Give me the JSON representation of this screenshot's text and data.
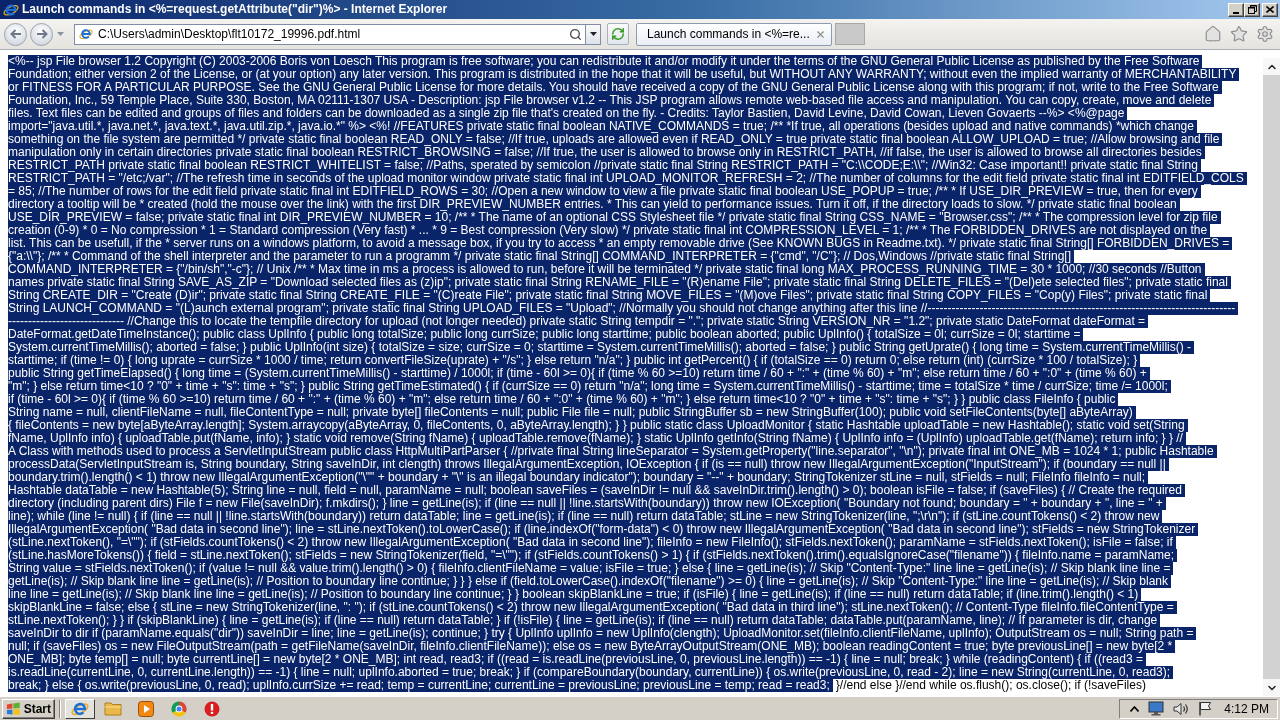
{
  "window": {
    "title": "Launch commands in <%=request.getAttribute(\"dir\")%> - Internet Explorer"
  },
  "address_bar": {
    "url": "C:\\Users\\admin\\Desktop\\flt10172_19996.pdf.html"
  },
  "tabs": [
    {
      "title": "Launch commands in <%=re...",
      "selected": true
    }
  ],
  "document": {
    "lines": [
      [
        {
          "text": "<%-- jsp File browser 1.2 Copyright (C) 2003-2006 Boris von Loesch This program is free software; you can redistribute it and/or modify it under the terms of the GNU General Public License as published by the Free Software",
          "selected": true
        }
      ],
      [
        {
          "text": "Foundation; either version 2 of the License, or (at your option) any later version. This program is distributed in the hope that it will be useful, but WITHOUT ANY WARRANTY; without even the implied warranty of MERCHANTABILITY",
          "selected": true
        }
      ],
      [
        {
          "text": "or FITNESS FOR A PARTICULAR PURPOSE. See the GNU General Public License for more details. You should have received a copy of the GNU General Public License along with this program; if not, write to the Free Software",
          "selected": true
        }
      ],
      [
        {
          "text": "Foundation, Inc., 59 Temple Place, Suite 330, Boston, MA 02111-1307 USA - Description: jsp File browser v1.2 -- This JSP program allows remote web-based file access and manipulation. You can copy, create, move and delete",
          "selected": true
        }
      ],
      [
        {
          "text": "files. Text files can be edited and groups of files and folders can be downloaded as a single zip file that's created on the fly. - Credits: Taylor Bastien, David Levine, David Cowan, Lieven Govaerts --%> <%@page",
          "selected": true
        }
      ],
      [
        {
          "text": "import=\"java.util.*, java.net.*, java.text.*, java.util.zip.*, java.io.*\" %> <%! //FEATURES private static final boolean NATIVE_COMMANDS = true; /** *If true, all operations (besides upload and native commands) *which change",
          "selected": true
        }
      ],
      [
        {
          "text": "something on the file system are permitted */ private static final boolean READ_ONLY = false; //If true, uploads are allowed even if READ_ONLY = true private static final boolean ALLOW_UPLOAD = true; //Allow browsing and file",
          "selected": true
        }
      ],
      [
        {
          "text": "manipulation only in certain directories private static final boolean RESTRICT_BROWSING = false; //If true, the user is allowed to browse only in RESTRICT_PATH, //if false, the user is allowed to browse all directories besides",
          "selected": true
        }
      ],
      [
        {
          "text": "RESTRICT_PATH private static final boolean RESTRICT_WHITELIST = false; //Paths, sperated by semicolon //private static final String RESTRICT_PATH = \"C:\\\\CODE;E:\\\\\"; //Win32: Case important!! private static final String",
          "selected": true
        }
      ],
      [
        {
          "text": "RESTRICT_PATH = \"/etc;/var\"; //The refresh time in seconds of the upload monitor window private static final int UPLOAD_MONITOR_REFRESH = 2; //The number of columns for the edit field private static final int EDITFIELD_COLS",
          "selected": true
        }
      ],
      [
        {
          "text": "= 85; //The number of rows for the edit field private static final int EDITFIELD_ROWS = 30; //Open a new window to view a file private static final boolean USE_POPUP = true; /** * If USE_DIR_PREVIEW = true, then for every",
          "selected": true
        }
      ],
      [
        {
          "text": "directory a tooltip will be * created (hold the mouse over the link) with the first DIR_PREVIEW_NUMBER entries. * This can yield to performance issues. Turn it off, if the directory loads to slow. */ private static final boolean",
          "selected": true
        }
      ],
      [
        {
          "text": "USE_DIR_PREVIEW = false; private static final int DIR_PREVIEW_NUMBER = 10; /** * The name of an optional CSS Stylesheet file */ private static final String CSS_NAME = \"Browser.css\"; /** * The compression level for zip file",
          "selected": true
        }
      ],
      [
        {
          "text": "creation (0-9) * 0 = No compression * 1 = Standard compression (Very fast) * ... * 9 = Best compression (Very slow) */ private static final int COMPRESSION_LEVEL = 1; /** * The FORBIDDEN_DRIVES are not displayed on the",
          "selected": true
        }
      ],
      [
        {
          "text": "list. This can be usefull, if the * server runs on a windows platform, to avoid a message box, if you try to access * an empty removable drive (See KNOWN BUGS in Readme.txt). */ private static final String[] FORBIDDEN_DRIVES =",
          "selected": true
        }
      ],
      [
        {
          "text": "{\"a:\\\\\"}; /** * Command of the shell interpreter and the parameter to run a programm */ private static final String[] COMMAND_INTERPRETER = {\"cmd\", \"/C\"}; // Dos,Windows //private static final String[]",
          "selected": true
        }
      ],
      [
        {
          "text": "COMMAND_INTERPRETER = {\"/bin/sh\",\"-c\"}; // Unix /** * Max time in ms a process is allowed to run, before it will be terminated */ private static final long MAX_PROCESS_RUNNING_TIME = 30 * 1000; //30 seconds //Button",
          "selected": true
        }
      ],
      [
        {
          "text": "names private static final String SAVE_AS_ZIP = \"Download selected files as (z)ip\"; private static final String RENAME_FILE = \"(R)ename File\"; private static final String DELETE_FILES = \"(Del)ete selected files\"; private static final",
          "selected": true
        }
      ],
      [
        {
          "text": "String CREATE_DIR = \"Create (D)ir\"; private static final String CREATE_FILE = \"(C)reate File\"; private static final String MOVE_FILES = \"(M)ove Files\"; private static final String COPY_FILES = \"Cop(y) Files\"; private static final",
          "selected": true
        }
      ],
      [
        {
          "text": "String LAUNCH_COMMAND = \"(L)aunch external program\"; private static final String UPLOAD_FILES = \"Upload\"; //Normally you should not change anything after this line //-----------------------------------------------------------------------------",
          "selected": true
        }
      ],
      [
        {
          "text": "----------------------------- //Change this to locate the tempfile directory for upload (not longer needed) private static String tempdir = \".\"; private static String VERSION_NR = \"1.2\"; private static DateFormat dateFormat =",
          "selected": true
        }
      ],
      [
        {
          "text": "DateFormat.getDateTimeInstance(); public class UplInfo { public long totalSize; public long currSize; public long starttime; public boolean aborted; public UplInfo() { totalSize = 0l; currSize = 0l; starttime =",
          "selected": true
        }
      ],
      [
        {
          "text": "System.currentTimeMillis(); aborted = false; } public UplInfo(int size) { totalSize = size; currSize = 0; starttime = System.currentTimeMillis(); aborted = false; } public String getUprate() { long time = System.currentTimeMillis() -",
          "selected": true
        }
      ],
      [
        {
          "text": "starttime; if (time != 0) { long uprate = currSize * 1000 / time; return convertFileSize(uprate) + \"/s\"; } else return \"n/a\"; } public int getPercent() { if (totalSize == 0) return 0; else return (int) (currSize * 100 / totalSize); }",
          "selected": true
        }
      ],
      [
        {
          "text": "public String getTimeElapsed() { long time = (System.currentTimeMillis() - starttime) / 1000l; if (time - 60l >= 0){ if (time % 60 >=10) return time / 60 + \":\" + (time % 60) + \"m\"; else return time / 60 + \":0\" + (time % 60) +",
          "selected": true
        }
      ],
      [
        {
          "text": "\"m\"; } else return time<10 ? \"0\" + time + \"s\": time + \"s\"; } public String getTimeEstimated() { if (currSize == 0) return \"n/a\"; long time = System.currentTimeMillis() - starttime; time = totalSize * time / currSize; time /= 1000l;",
          "selected": true
        }
      ],
      [
        {
          "text": "if (time - 60l >= 0){ if (time % 60 >=10) return time / 60 + \":\" + (time % 60) + \"m\"; else return time / 60 + \":0\" + (time % 60) + \"m\"; } else return time<10 ? \"0\" + time + \"s\": time + \"s\"; } } public class FileInfo { public",
          "selected": true
        }
      ],
      [
        {
          "text": "String name = null, clientFileName = null, fileContentType = null; private byte[] fileContents = null; public File file = null; public StringBuffer sb = new StringBuffer(100); public void setFileContents(byte[] aByteArray)",
          "selected": true
        }
      ],
      [
        {
          "text": "{ fileContents = new byte[aByteArray.length]; System.arraycopy(aByteArray, 0, fileContents, 0, aByteArray.length); } } public static class UploadMonitor { static Hashtable uploadTable = new Hashtable(); static void set(String",
          "selected": true
        }
      ],
      [
        {
          "text": "fName, UplInfo info) { uploadTable.put(fName, info); } static void remove(String fName) { uploadTable.remove(fName); } static UplInfo getInfo(String fName) { UplInfo info = (UplInfo) uploadTable.get(fName); return info; } } //",
          "selected": true
        }
      ],
      [
        {
          "text": "A Class with methods used to process a ServletInputStream public class HttpMultiPartParser { //private final String lineSeparator = System.getProperty(\"line.separator\", \"\\n\"); private final int ONE_MB = 1024 * 1; public Hashtable",
          "selected": true
        }
      ],
      [
        {
          "text": "processData(ServletInputStream is, String boundary, String saveInDir, int clength) throws IllegalArgumentException, IOException { if (is == null) throw new IllegalArgumentException(\"InputStream\"); if (boundary == null ||",
          "selected": true
        }
      ],
      [
        {
          "text": "boundary.trim().length() < 1) throw new IllegalArgumentException(\"\\\"\" + boundary + \"\\\" is an illegal boundary indicator\"); boundary = \"--\" + boundary; StringTokenizer stLine = null, stFields = null; FileInfo fileInfo = null;",
          "selected": true
        }
      ],
      [
        {
          "text": "Hashtable dataTable = new Hashtable(5); String line = null, field = null, paramName = null; boolean saveFiles = (saveInDir != null && saveInDir.trim().length() > 0); boolean isFile = false; if (saveFiles) { // Create the required",
          "selected": true
        }
      ],
      [
        {
          "text": "directory (including parent dirs) File f = new File(saveInDir); f.mkdirs(); } line = getLine(is); if (line == null || !line.startsWith(boundary)) throw new IOException( \"Boundary not found; boundary = \" + boundary + \", line = \" +",
          "selected": true
        }
      ],
      [
        {
          "text": "line); while (line != null) { if (line == null || !line.startsWith(boundary)) return dataTable; line = getLine(is); if (line == null) return dataTable; stLine = new StringTokenizer(line, \";\\r\\n\"); if (stLine.countTokens() < 2) throw new",
          "selected": true
        }
      ],
      [
        {
          "text": "IllegalArgumentException( \"Bad data in second line\"); line = stLine.nextToken().toLowerCase(); if (line.indexOf(\"form-data\") < 0) throw new IllegalArgumentException( \"Bad data in second line\"); stFields = new StringTokenizer",
          "selected": true
        }
      ],
      [
        {
          "text": "(stLine.nextToken(), \"=\\\"\"); if (stFields.countTokens() < 2) throw new IllegalArgumentException( \"Bad data in second line\"); fileInfo = new FileInfo(); stFields.nextToken(); paramName = stFields.nextToken(); isFile = false; if",
          "selected": true
        }
      ],
      [
        {
          "text": "(stLine.hasMoreTokens()) { field = stLine.nextToken(); stFields = new StringTokenizer(field, \"=\\\"\"); if (stFields.countTokens() > 1) { if (stFields.nextToken().trim().equalsIgnoreCase(\"filename\")) { fileInfo.name = paramName;",
          "selected": true
        }
      ],
      [
        {
          "text": "String value = stFields.nextToken(); if (value != null && value.trim().length() > 0) { fileInfo.clientFileName = value; isFile = true; } else { line = getLine(is); // Skip \"Content-Type:\" line line = getLine(is); // Skip blank line line =",
          "selected": true
        }
      ],
      [
        {
          "text": "getLine(is); // Skip blank line line = getLine(is); // Position to boundary line continue; } } } else if (field.toLowerCase().indexOf(\"filename\") >= 0) { line = getLine(is); // Skip \"Content-Type:\" line line = getLine(is); // Skip blank",
          "selected": true
        }
      ],
      [
        {
          "text": "line line = getLine(is); // Skip blank line line = getLine(is); // Position to boundary line continue; } } boolean skipBlankLine = true; if (isFile) { line = getLine(is); if (line == null) return dataTable; if (line.trim().length() < 1)",
          "selected": true
        }
      ],
      [
        {
          "text": "skipBlankLine = false; else { stLine = new StringTokenizer(line, \": \"); if (stLine.countTokens() < 2) throw new IllegalArgumentException( \"Bad data in third line\"); stLine.nextToken(); // Content-Type fileInfo.fileContentType =",
          "selected": true
        }
      ],
      [
        {
          "text": "stLine.nextToken(); } } if (skipBlankLine) { line = getLine(is); if (line == null) return dataTable; } if (!isFile) { line = getLine(is); if (line == null) return dataTable; dataTable.put(paramName, line); // If parameter is dir, change",
          "selected": true
        }
      ],
      [
        {
          "text": "saveInDir to dir if (paramName.equals(\"dir\")) saveInDir = line; line = getLine(is); continue; } try { UplInfo uplInfo = new UplInfo(clength); UploadMonitor.set(fileInfo.clientFileName, uplInfo); OutputStream os = null; String path =",
          "selected": true
        }
      ],
      [
        {
          "text": "null; if (saveFiles) os = new FileOutputStream(path = getFileName(saveInDir, fileInfo.clientFileName)); else os = new ByteArrayOutputStream(ONE_MB); boolean readingContent = true; byte previousLine[] = new byte[2 *",
          "selected": true
        }
      ],
      [
        {
          "text": "ONE_MB]; byte temp[] = null; byte currentLine[] = new byte[2 * ONE_MB]; int read, read3; if ((read = is.readLine(previousLine, 0, previousLine.length)) == -1) { line = null; break; } while (readingContent) { if ((read3 =",
          "selected": true
        }
      ],
      [
        {
          "text": "is.readLine(currentLine, 0, currentLine.length)) == -1) { line = null; uplInfo.aborted = true; break; } if (compareBoundary(boundary, currentLine)) { os.write(previousLine, 0, read - 2); line = new String(currentLine, 0, read3);",
          "selected": true
        }
      ],
      [
        {
          "text": "break; } else { os.write(previousLine, 0, read); uplInfo.currSize += read; temp = currentLine; currentLine = previousLine; previousLine = temp; read = read3;",
          "selected": true
        },
        {
          "text": "}//end else }//end while os.flush(); os.close(); if (!saveFiles)",
          "selected": false
        }
      ]
    ]
  },
  "taskbar": {
    "start": "Start",
    "quick_launch": [
      {
        "selected": true
      },
      {
        "selected": false
      },
      {
        "selected": false
      },
      {
        "selected": false
      },
      {
        "selected": false
      }
    ],
    "clock": "4:12 PM"
  }
}
